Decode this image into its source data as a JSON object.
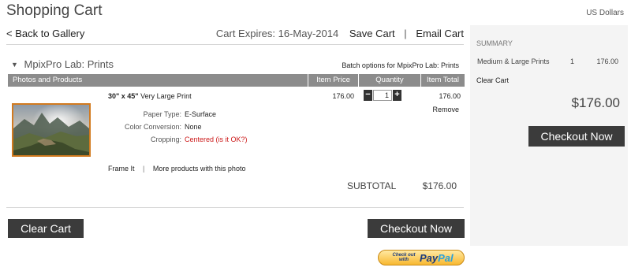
{
  "page": {
    "title": "Shopping Cart",
    "currency": "US Dollars"
  },
  "topbar": {
    "back_label": "< Back to Gallery",
    "expires_label": "Cart Expires: 16-May-2014",
    "save_label": "Save Cart",
    "separator": "|",
    "email_label": "Email Cart"
  },
  "lab": {
    "name": "MpixPro Lab: Prints",
    "batch_label": "Batch options for MpixPro Lab: Prints"
  },
  "table": {
    "headers": {
      "photos": "Photos and Products",
      "price": "Item Price",
      "quantity": "Quantity",
      "total": "Item Total"
    }
  },
  "item": {
    "size": "30\" x 45\"",
    "product": "Very Large Print",
    "attributes": [
      {
        "label": "Paper Type:",
        "value": "E-Surface"
      },
      {
        "label": "Color Conversion:",
        "value": "None"
      },
      {
        "label": "Cropping:",
        "value": "Centered (is it OK?)"
      }
    ],
    "price": "176.00",
    "quantity": "1",
    "total": "176.00",
    "remove_label": "Remove",
    "frame_label": "Frame It",
    "separator": "|",
    "more_label": "More products with this photo",
    "photo_frame_color": "#d27a1f"
  },
  "subtotal": {
    "label": "SUBTOTAL",
    "value": "$176.00"
  },
  "actions": {
    "clear_cart": "Clear Cart",
    "checkout": "Checkout Now",
    "paypal_small_1": "Check out",
    "paypal_small_2": "with",
    "paypal_pay": "Pay",
    "paypal_pal": "Pal"
  },
  "summary": {
    "title": "SUMMARY",
    "item_label": "Medium & Large Prints",
    "item_qty": "1",
    "item_amount": "176.00",
    "clear_label": "Clear Cart",
    "total": "$176.00",
    "checkout_label": "Checkout Now"
  },
  "colors": {
    "button_dark": "#3b3b3b",
    "table_header": "#8c8c8c",
    "alert_red": "#cc1a1a",
    "summary_bg": "#f4f4f4"
  }
}
